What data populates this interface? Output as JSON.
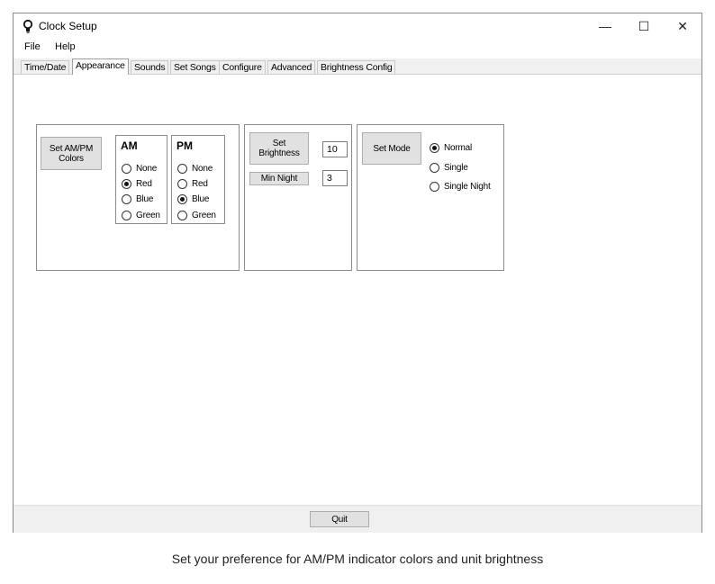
{
  "window": {
    "title": "Clock Setup"
  },
  "titlebar": {
    "minimize": "—",
    "maximize": "☐",
    "close": "✕"
  },
  "menu": [
    "File",
    "Help"
  ],
  "tabs": [
    {
      "label": "Time/Date",
      "active": false
    },
    {
      "label": "Appearance",
      "active": true
    },
    {
      "label": "Sounds",
      "active": false
    },
    {
      "label": "Set Songs",
      "active": false
    },
    {
      "label": "Configure",
      "active": false
    },
    {
      "label": "Advanced",
      "active": false
    },
    {
      "label": "Brightness Config",
      "active": false
    }
  ],
  "colors_panel": {
    "button_label": "Set AM/PM\nColors",
    "am": {
      "title": "AM",
      "options": [
        "None",
        "Red",
        "Blue",
        "Green"
      ],
      "selected": "Red"
    },
    "pm": {
      "title": "PM",
      "options": [
        "None",
        "Red",
        "Blue",
        "Green"
      ],
      "selected": "Blue"
    }
  },
  "brightness_panel": {
    "button_label": "Set\nBrightness",
    "brightness_value": "10",
    "min_night_label": "Min Night",
    "min_night_value": "3"
  },
  "mode_panel": {
    "button_label": "Set Mode",
    "options": [
      "Normal",
      "Single",
      "Single Night"
    ],
    "selected": "Normal"
  },
  "footer": {
    "quit_label": "Quit"
  },
  "caption": "Set your preference for AM/PM indicator colors and unit brightness"
}
